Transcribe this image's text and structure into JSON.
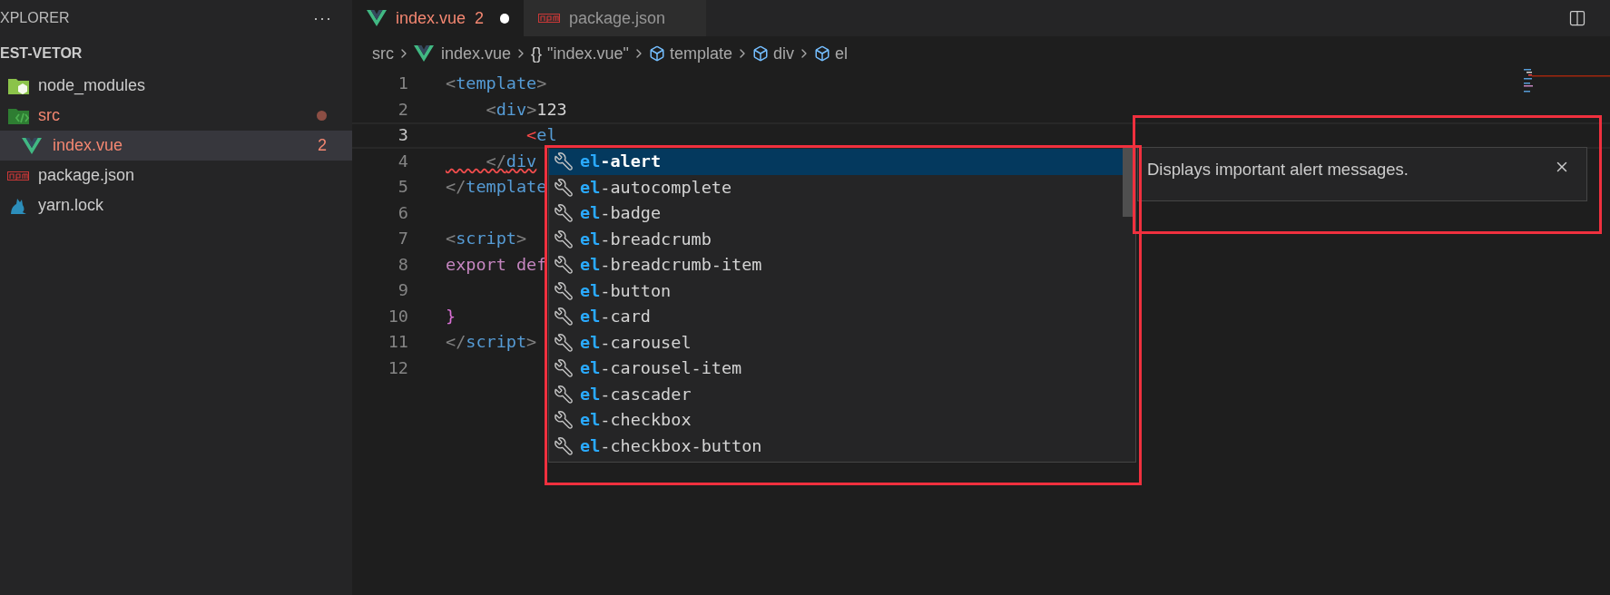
{
  "sidebar": {
    "title": "XPLORER",
    "more": "···",
    "project": "EST-VETOR",
    "items": [
      {
        "label": "node_modules",
        "kind": "folder-node",
        "modified": false,
        "selected": false
      },
      {
        "label": "src",
        "kind": "folder-src",
        "modified": true,
        "selected": false,
        "dot": true,
        "children": [
          {
            "label": "index.vue",
            "kind": "vue",
            "modified": true,
            "selected": true,
            "badge": "2"
          }
        ]
      },
      {
        "label": "package.json",
        "kind": "npm",
        "modified": false,
        "selected": false
      },
      {
        "label": "yarn.lock",
        "kind": "yarn",
        "modified": false,
        "selected": false
      }
    ]
  },
  "tabs": [
    {
      "label": "index.vue",
      "kind": "vue",
      "problems": "2",
      "dirty": true,
      "selected": true
    },
    {
      "label": "package.json",
      "kind": "npm",
      "dirty": false,
      "selected": false
    }
  ],
  "breadcrumb": [
    {
      "label": "src",
      "kind": "plain"
    },
    {
      "label": "index.vue",
      "kind": "vue"
    },
    {
      "label": "\"index.vue\"",
      "kind": "braces",
      "glyph": "{}"
    },
    {
      "label": "template",
      "kind": "symbol"
    },
    {
      "label": "div",
      "kind": "symbol"
    },
    {
      "label": "el",
      "kind": "symbol"
    }
  ],
  "code": [
    {
      "number": "1",
      "current": false,
      "tokens": [
        {
          "text": "<",
          "kind": "punct"
        },
        {
          "text": "template",
          "kind": "tag"
        },
        {
          "text": ">",
          "kind": "punct"
        }
      ]
    },
    {
      "number": "2",
      "current": false,
      "tokens": [
        {
          "text": "    <",
          "kind": "punct"
        },
        {
          "text": "div",
          "kind": "tag"
        },
        {
          "text": ">",
          "kind": "punct"
        },
        {
          "text": "123",
          "kind": "text"
        }
      ]
    },
    {
      "number": "3",
      "current": true,
      "tokens": [
        {
          "text": "        <",
          "kind": "error"
        },
        {
          "text": "el",
          "kind": "tag"
        }
      ]
    },
    {
      "number": "4",
      "current": false,
      "tokens": [
        {
          "text": "    </",
          "kind": "punct",
          "squiggly": true
        },
        {
          "text": "div",
          "kind": "tag",
          "squiggly": true
        }
      ]
    },
    {
      "number": "5",
      "current": false,
      "tokens": [
        {
          "text": "</",
          "kind": "punct"
        },
        {
          "text": "template",
          "kind": "tag"
        }
      ]
    },
    {
      "number": "6",
      "current": false
    },
    {
      "number": "7",
      "current": false,
      "tokens": [
        {
          "text": "<",
          "kind": "punct"
        },
        {
          "text": "script",
          "kind": "tag"
        },
        {
          "text": ">",
          "kind": "punct"
        }
      ]
    },
    {
      "number": "8",
      "current": false,
      "tokens": [
        {
          "text": "export def",
          "kind": "keyword"
        }
      ]
    },
    {
      "number": "9",
      "current": false
    },
    {
      "number": "10",
      "current": false,
      "tokens": [
        {
          "text": "}",
          "kind": "brace"
        }
      ]
    },
    {
      "number": "11",
      "current": false,
      "tokens": [
        {
          "text": "</",
          "kind": "punct"
        },
        {
          "text": "script",
          "kind": "tag"
        },
        {
          "text": ">",
          "kind": "punct"
        }
      ]
    },
    {
      "number": "12",
      "current": false
    }
  ],
  "suggest": {
    "items": [
      {
        "label": "**el**-alert",
        "selected": true
      },
      {
        "label": "**el**-autocomplete",
        "selected": false
      },
      {
        "label": "**el**-badge",
        "selected": false
      },
      {
        "label": "**el**-breadcrumb",
        "selected": false
      },
      {
        "label": "**el**-breadcrumb-item",
        "selected": false
      },
      {
        "label": "**el**-button",
        "selected": false
      },
      {
        "label": "**el**-card",
        "selected": false
      },
      {
        "label": "**el**-carousel",
        "selected": false
      },
      {
        "label": "**el**-carousel-item",
        "selected": false
      },
      {
        "label": "**el**-cascader",
        "selected": false
      },
      {
        "label": "**el**-checkbox",
        "selected": false
      },
      {
        "label": "**el**-checkbox-button",
        "selected": false
      }
    ]
  },
  "details": {
    "text": "Displays important alert messages."
  }
}
